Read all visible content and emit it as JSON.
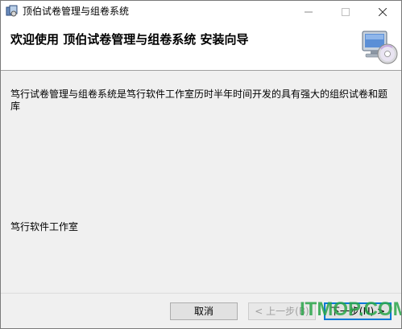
{
  "window": {
    "title": "顶伯试卷管理与组卷系统",
    "controls": {
      "minimize_icon": "minimize-icon",
      "maximize_icon": "maximize-icon",
      "close_icon": "close-icon"
    }
  },
  "header": {
    "title": "欢迎使用  顶伯试卷管理与组卷系统  安装向导",
    "icon": "computer-setup-icon"
  },
  "body": {
    "description": "笃行试卷管理与组卷系统是笃行软件工作室历时半年时间开发的具有强大的组织试卷和题库",
    "company": "笃行软件工作室"
  },
  "footer": {
    "cancel_label": "取消",
    "back_label": "< 上一步(B)",
    "next_label": "下一步(N) >"
  },
  "watermark": {
    "text": "ITMOP.COM"
  },
  "colors": {
    "accent": "#0078d7",
    "watermark": "#2aa64a",
    "background": "#f0f0f0"
  }
}
